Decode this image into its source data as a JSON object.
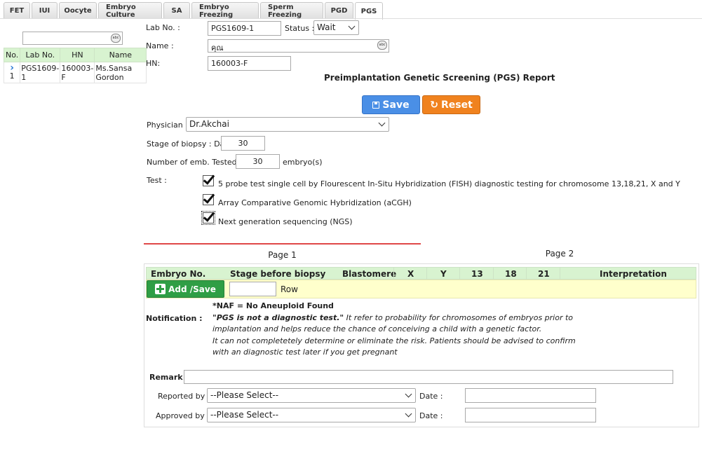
{
  "tabs": [
    "FET",
    "IUI",
    "Oocyte",
    "Embryo Culture",
    "SA",
    "Embryo Freezing",
    "Sperm Freezing",
    "PGD",
    "PGS"
  ],
  "active_tab": "PGS",
  "left_grid": {
    "headers": [
      "No.",
      "Lab No.",
      "HN",
      "Name"
    ],
    "rows": [
      {
        "no": "1",
        "lab_no": "PGS1609-1",
        "hn": "160003-F",
        "name": "Ms.Sansa Gordon"
      }
    ]
  },
  "form": {
    "lab_no_label": "Lab No. :",
    "lab_no_value": "PGS1609-1",
    "status_label": "Status :",
    "status_value": "Wait",
    "name_label": "Name :",
    "name_value": "คุณ",
    "hn_label": "HN:",
    "hn_value": "160003-F",
    "report_title": "Preimplantation Genetic Screening (PGS) Report",
    "save_label": "Save",
    "reset_label": "Reset",
    "physician_label": "Physician :",
    "physician_value": "Dr.Akchai",
    "stage_label": "Stage of biopsy : Day",
    "stage_value": "30",
    "num_tested_label": "Number of emb. Tested :",
    "num_tested_value": "30",
    "num_tested_unit": "embryo(s)",
    "test_label": "Test :",
    "tests": [
      {
        "label": "5 probe test single cell by Flourescent In-Situ Hybridization (FISH) diagnostic testing for chromosome 13,18,21, X and Y",
        "checked": true
      },
      {
        "label": "Array Comparative Genomic Hybridization (aCGH)",
        "checked": true
      },
      {
        "label": "Next generation sequencing (NGS)",
        "checked": true
      }
    ]
  },
  "page_tabs": [
    "Page 1",
    "Page 2"
  ],
  "results_table": {
    "headers": [
      "Embryo No.",
      "Stage before biopsy",
      "Blastomere",
      "X",
      "Y",
      "13",
      "18",
      "21",
      "Interpretation"
    ],
    "add_button": "Add /Save",
    "row_label": "Row"
  },
  "notification": {
    "naf": "*NAF = No Aneuploid Found",
    "label": "Notification :",
    "bold_line": "\"PGS is not a diagnostic test.\"",
    "line1_rest": " It refer to probability for chromosomes of embryos prior to",
    "line2": "implantation and helps reduce the chance of conceiving a child with a genetic factor.",
    "line3": "It can not completetely determine or eliminate the risk. Patients should be advised to confirm",
    "line4": "with an diagnostic test later if you get pregnant"
  },
  "remark_label": "Remark :",
  "reported_by_label": "Reported by :",
  "reported_by_value": "--Please Select--",
  "approved_by_label": "Approved by :",
  "approved_by_value": "--Please Select--",
  "date_label": "Date :",
  "colors": {
    "save": "#4a8fe6",
    "reset": "#f0821e",
    "add": "#2f9e45",
    "header_green": "#d8f3d0",
    "row_yellow": "#ffffcc",
    "active_page_line": "#e04848"
  }
}
